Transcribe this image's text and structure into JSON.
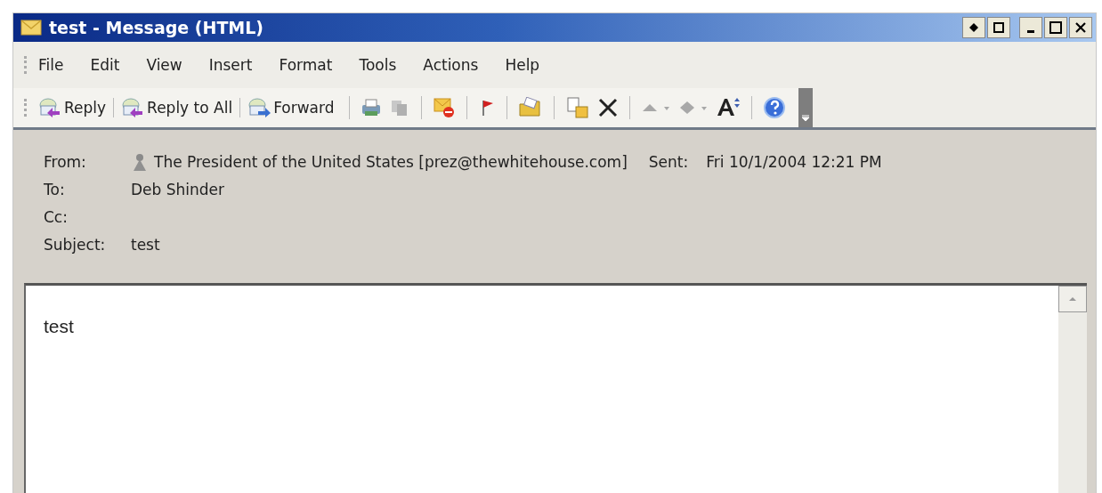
{
  "window": {
    "title": "test - Message (HTML)"
  },
  "menu": [
    "File",
    "Edit",
    "View",
    "Insert",
    "Format",
    "Tools",
    "Actions",
    "Help"
  ],
  "toolbar": {
    "buttons": [
      "Reply",
      "Reply to All",
      "Forward"
    ]
  },
  "header": {
    "from_label": "From:",
    "from": "The President of the United States [prez@thewhitehouse.com]",
    "sent_label": "Sent:",
    "sent": "Fri 10/1/2004 12:21 PM",
    "to_label": "To:",
    "to": "Deb Shinder",
    "cc_label": "Cc:",
    "subject_label": "Subject:",
    "subject": "test"
  },
  "body": {
    "text": "test"
  }
}
